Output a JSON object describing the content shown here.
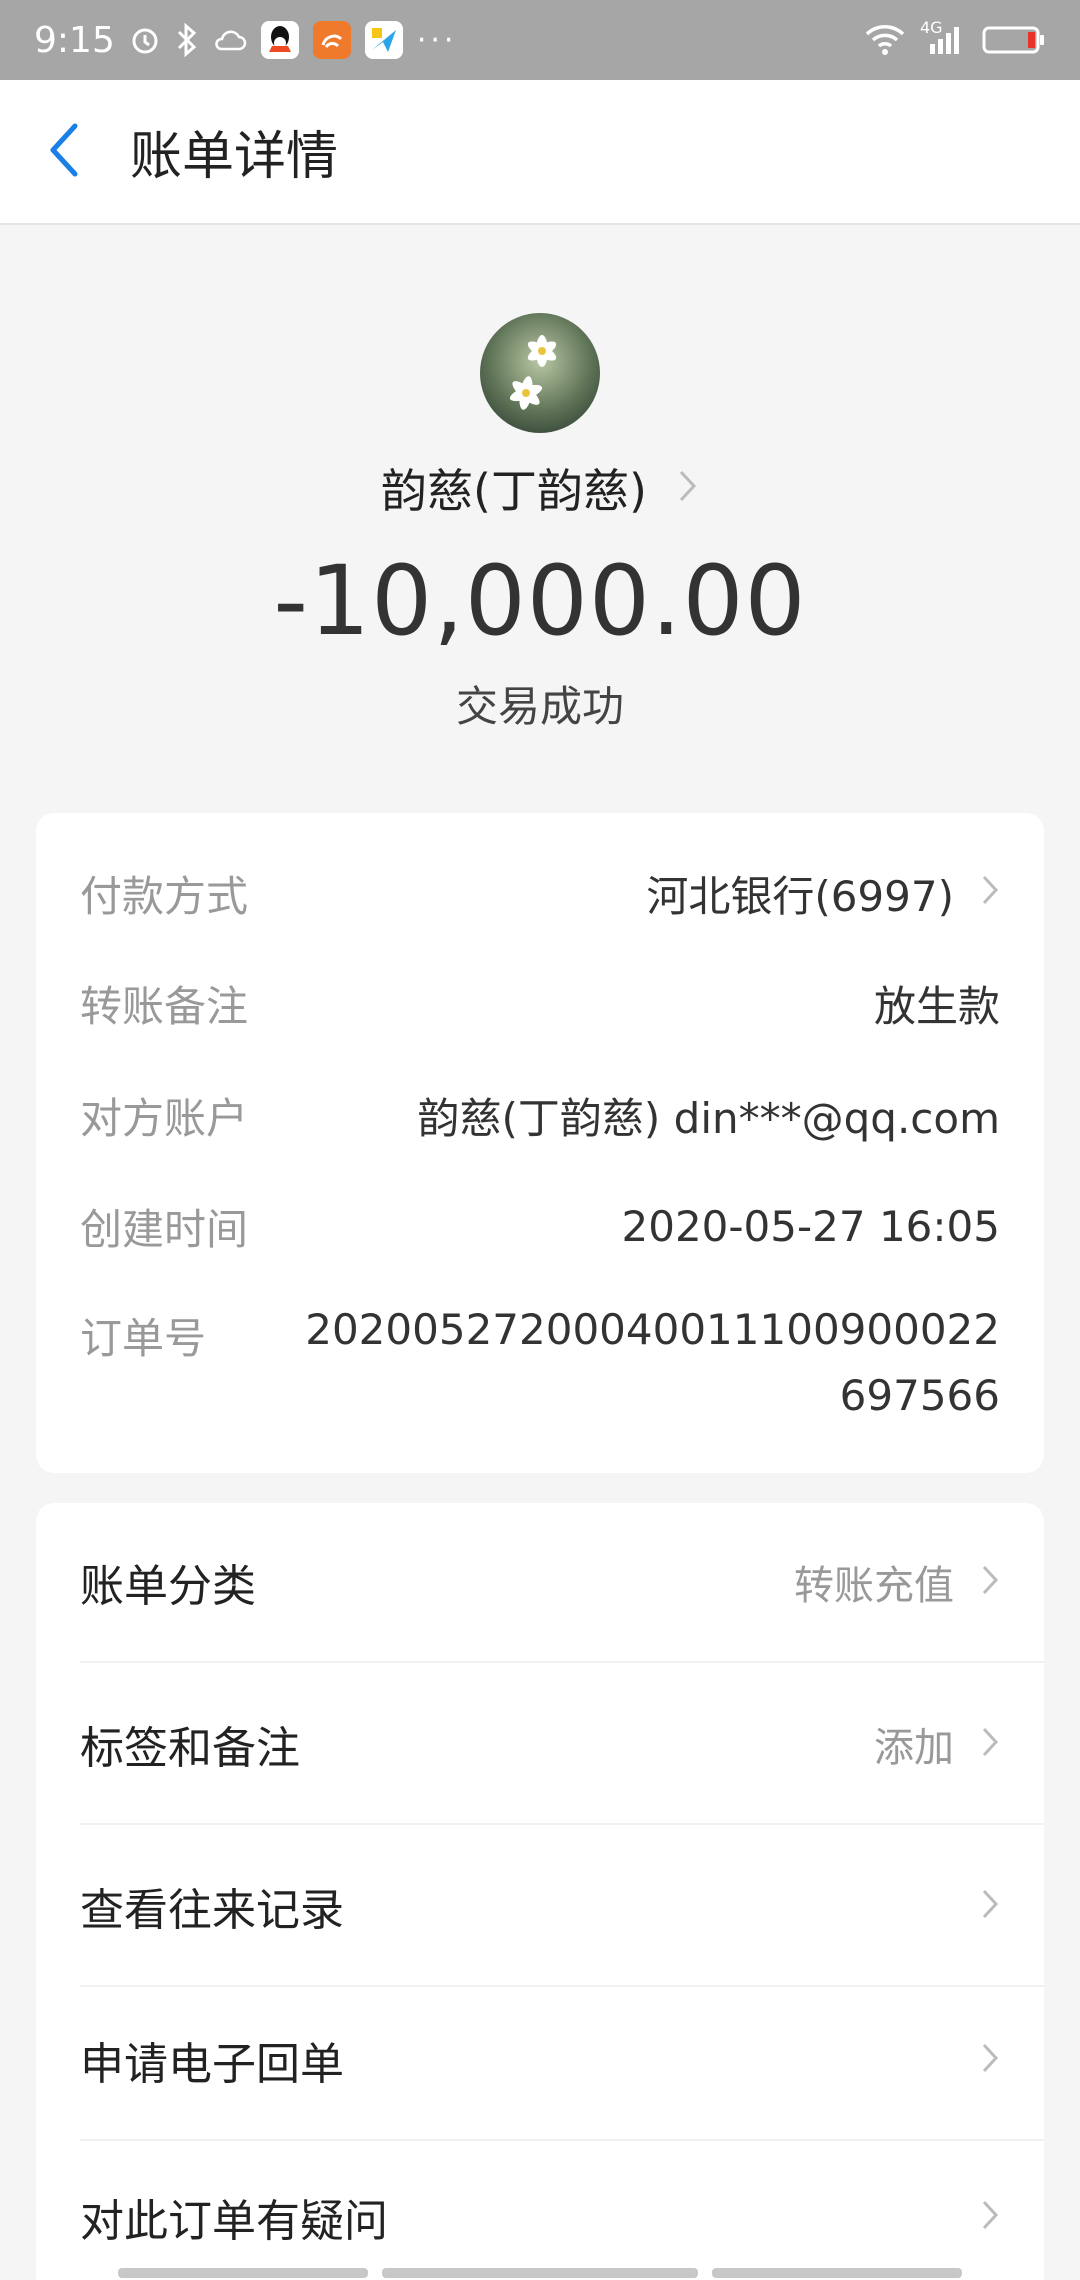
{
  "status_bar": {
    "time": "9:15",
    "more": "···",
    "network": "4G"
  },
  "nav": {
    "title": "账单详情"
  },
  "header": {
    "name": "韵慈(丁韵慈)",
    "amount": "-10,000.00",
    "status": "交易成功"
  },
  "details": {
    "payment_method": {
      "label": "付款方式",
      "value": "河北银行(6997)"
    },
    "transfer_note": {
      "label": "转账备注",
      "value": "放生款"
    },
    "counterparty": {
      "label": "对方账户",
      "value": "韵慈(丁韵慈) din***@qq.com"
    },
    "created_time": {
      "label": "创建时间",
      "value": "2020-05-27 16:05"
    },
    "order_no": {
      "label": "订单号",
      "value": "20200527200040011100900022697566"
    }
  },
  "menu": [
    {
      "label": "账单分类",
      "value": "转账充值"
    },
    {
      "label": "标签和备注",
      "value": "添加"
    },
    {
      "label": "查看往来记录",
      "value": ""
    },
    {
      "label": "申请电子回单",
      "value": ""
    },
    {
      "label": "对此订单有疑问",
      "value": ""
    }
  ],
  "colors": {
    "accent": "#1a7fe6",
    "status_bar": "#a6a6a6",
    "background": "#f5f5f5"
  },
  "icons": [
    "alarm-icon",
    "bluetooth-icon",
    "weather-icon",
    "qq-icon",
    "uc-browser-icon",
    "app-icon",
    "wifi-icon",
    "signal-icon",
    "battery-icon",
    "back-arrow-icon",
    "chevron-right-icon"
  ]
}
